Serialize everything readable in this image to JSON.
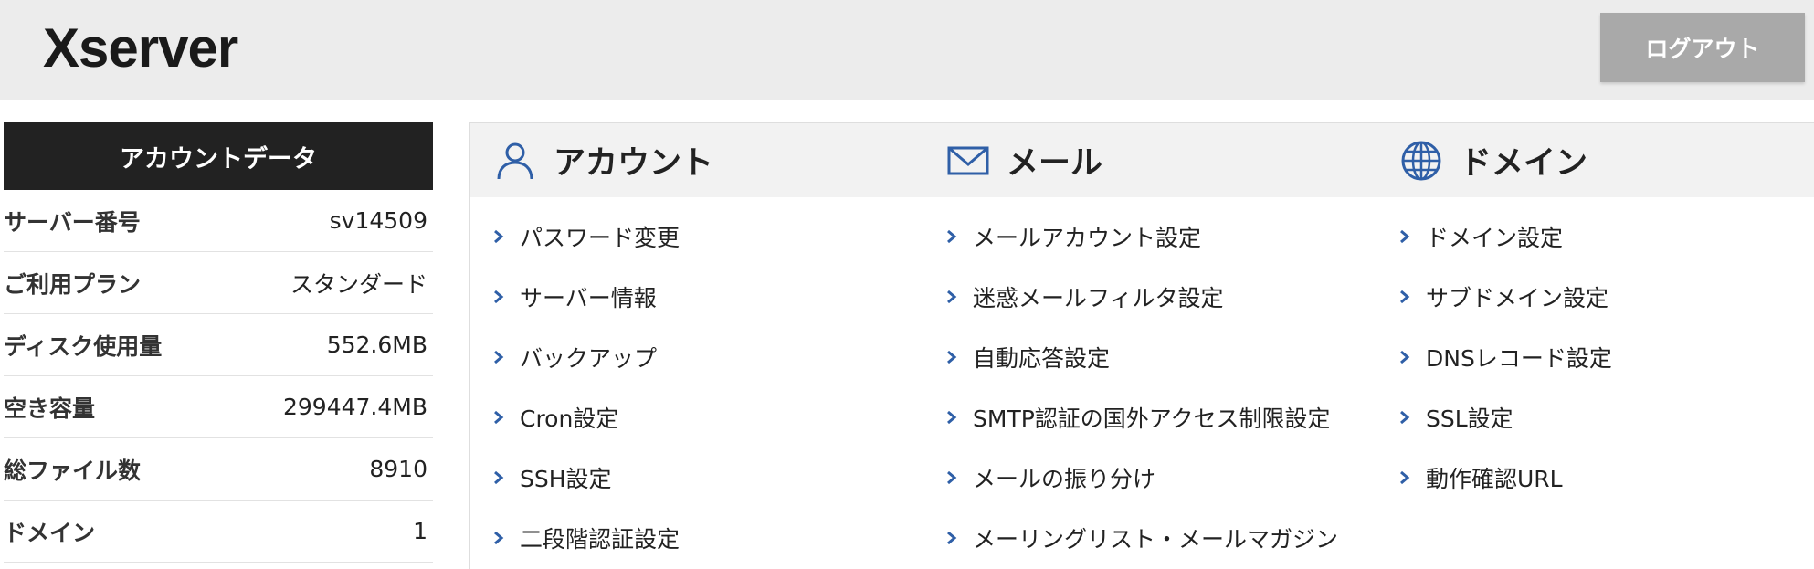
{
  "header": {
    "logo_text": "Xserver",
    "logout_label": "ログアウト"
  },
  "account": {
    "title": "アカウントデータ",
    "rows": [
      {
        "label": "サーバー番号",
        "value": "sv14509"
      },
      {
        "label": "ご利用プラン",
        "value": "スタンダード"
      },
      {
        "label": "ディスク使用量",
        "value": "552.6MB"
      },
      {
        "label": "空き容量",
        "value": "299447.4MB"
      },
      {
        "label": "総ファイル数",
        "value": "8910"
      },
      {
        "label": "ドメイン",
        "value": "1"
      }
    ]
  },
  "menus": [
    {
      "title": "アカウント",
      "icon": "user-icon",
      "items": [
        "パスワード変更",
        "サーバー情報",
        "バックアップ",
        "Cron設定",
        "SSH設定",
        "二段階認証設定"
      ]
    },
    {
      "title": "メール",
      "icon": "mail-icon",
      "items": [
        "メールアカウント設定",
        "迷惑メールフィルタ設定",
        "自動応答設定",
        "SMTP認証の国外アクセス制限設定",
        "メールの振り分け",
        "メーリングリスト・メールマガジン"
      ]
    },
    {
      "title": "ドメイン",
      "icon": "globe-icon",
      "items": [
        "ドメイン設定",
        "サブドメイン設定",
        "DNSレコード設定",
        "SSL設定",
        "動作確認URL"
      ]
    }
  ],
  "colors": {
    "accent_blue": "#2f5fa7",
    "header_bg": "#ececec",
    "panel_dark": "#222222",
    "logout_bg": "#a9a9a9"
  }
}
